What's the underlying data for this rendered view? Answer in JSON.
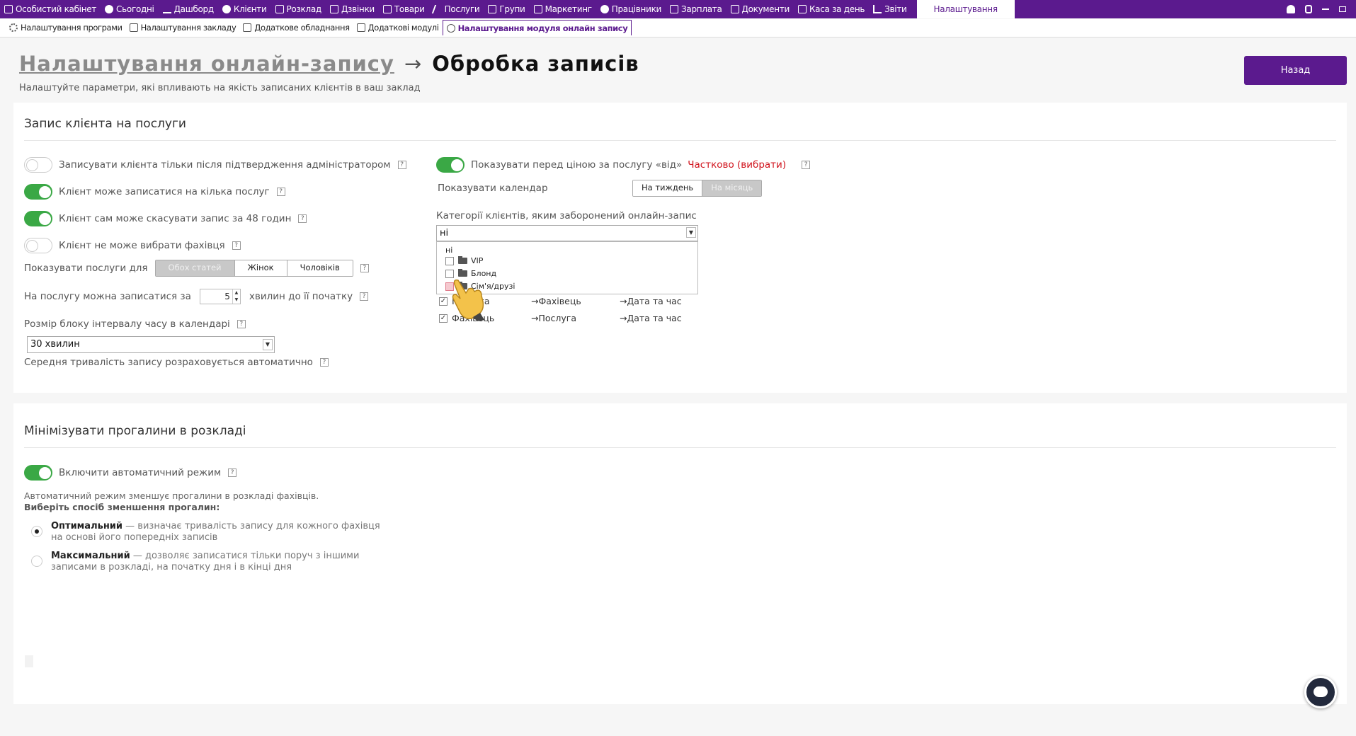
{
  "topnav": {
    "items": [
      {
        "label": "Особистий кабінет",
        "icon": "briefcase-icon"
      },
      {
        "label": "Сьогодні",
        "icon": "clock-icon"
      },
      {
        "label": "Дашборд",
        "icon": "pulse-icon"
      },
      {
        "label": "Клієнти",
        "icon": "user-circle-icon"
      },
      {
        "label": "Розклад",
        "icon": "calendar-icon"
      },
      {
        "label": "Дзвінки",
        "icon": "phone-icon"
      },
      {
        "label": "Товари",
        "icon": "box-icon"
      },
      {
        "label": "Послуги",
        "icon": "bolt-icon"
      },
      {
        "label": "Групи",
        "icon": "grid-icon"
      },
      {
        "label": "Маркетинг",
        "icon": "megaphone-icon"
      },
      {
        "label": "Працівники",
        "icon": "person-icon"
      },
      {
        "label": "Зарплата",
        "icon": "money-icon"
      },
      {
        "label": "Документи",
        "icon": "document-icon"
      },
      {
        "label": "Каса за день",
        "icon": "calculator-icon"
      },
      {
        "label": "Звіти",
        "icon": "bar-chart-icon"
      }
    ],
    "active": "Налаштування"
  },
  "subnav": {
    "items": [
      {
        "label": "Налаштування програми",
        "icon": "gear-icon"
      },
      {
        "label": "Налаштування закладу",
        "icon": "building-icon"
      },
      {
        "label": "Додаткове обладнання",
        "icon": "printer-icon"
      },
      {
        "label": "Додаткові модулі",
        "icon": "modules-icon"
      }
    ],
    "active": "Налаштування модуля онлайн запису"
  },
  "header": {
    "crumb": "Налаштування онлайн-запису",
    "arrow": "→",
    "title": "Обробка записів",
    "subtitle": "Налаштуйте параметри, які впливають на якість записаних клієнтів в ваш заклад",
    "back": "Назад"
  },
  "section1": {
    "title": "Запис клієнта на послуги",
    "toggles": [
      {
        "label": "Записувати клієнта тільки після підтвердження адміністратором",
        "on": false
      },
      {
        "label": "Клієнт може записатися на кілька послуг",
        "on": true
      },
      {
        "label": "Клієнт сам може скасувати запис за 48 годин",
        "on": true
      },
      {
        "label": "Клієнт не може вибрати фахівця",
        "on": false
      }
    ],
    "show_services_label": "Показувати послуги для",
    "gender_options": [
      "Обох статей",
      "Жінок",
      "Чоловіків"
    ],
    "gender_selected": "Обох статей",
    "minutes_before": "На послугу можна записатися за",
    "minutes_value": "5",
    "minutes_after": "хвилин до її початку",
    "block_size_label": "Розмір блоку інтервалу часу в календарі",
    "block_size_value": "30 хвилин",
    "avg_duration": "Середня тривалість запису розраховується автоматично",
    "price_from_label": "Показувати перед ціною за послугу «від»",
    "price_from_on": true,
    "price_from_link": "Частково (вибрати)",
    "calendar_label": "Показувати календар",
    "calendar_options": [
      "На тиждень",
      "На місяць"
    ],
    "calendar_selected": "На місяць",
    "categories_label": "Категорії клієнтів, яким заборонений онлайн-запис",
    "categories_value": "ні",
    "categories_options": [
      {
        "label": "ні",
        "folder": false
      },
      {
        "label": "VIP",
        "folder": true
      },
      {
        "label": "Блонд",
        "folder": true
      },
      {
        "label": "Сім'я/друзі",
        "folder": true
      }
    ],
    "mapping": [
      {
        "label": "Послуга",
        "a": "→Фахівець",
        "b": "→Дата та час"
      },
      {
        "label": "Фахівець",
        "a": "→Послуга",
        "b": "→Дата та час"
      }
    ]
  },
  "section2": {
    "title": "Мінімізувати прогалини в розкладі",
    "auto_label": "Включити автоматичний режим",
    "auto_on": true,
    "desc": "Автоматичний режим зменшує прогалини в розкладі фахівців.",
    "desc_bold": "Виберіть спосіб зменшення прогалин:",
    "options": [
      {
        "title": "Оптимальний",
        "text": " — визначає тривалість запису для кожного фахівця на основі його попередніх записів",
        "selected": true
      },
      {
        "title": "Максимальний",
        "text": " — дозволяє записатися тільки поруч з іншими записами в розкладі, на початку дня і в кінці дня",
        "selected": false
      }
    ]
  },
  "colors": {
    "brand": "#5b1a8e",
    "toggle_on": "#3aa845",
    "link": "#d0121b"
  }
}
